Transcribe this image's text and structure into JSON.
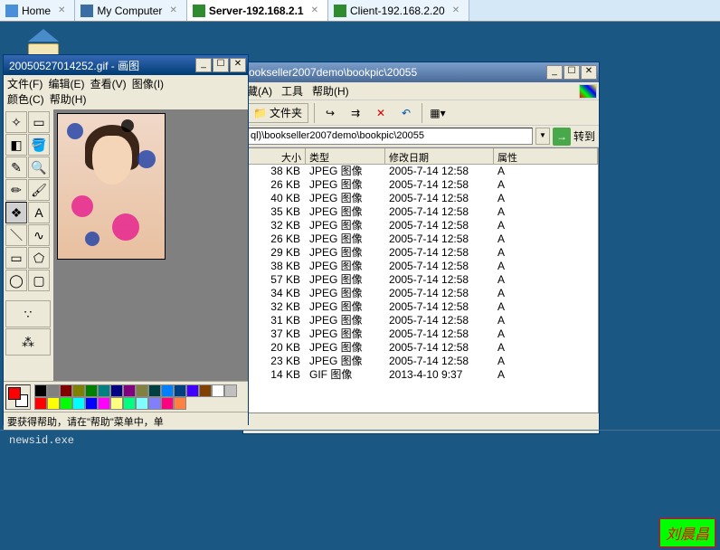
{
  "tabs": [
    {
      "label": "Home",
      "icon": "home"
    },
    {
      "label": "My Computer",
      "icon": "computer"
    },
    {
      "label": "Server-192.168.2.1",
      "icon": "server",
      "active": true
    },
    {
      "label": "Client-192.168.2.20",
      "icon": "client"
    }
  ],
  "paint": {
    "title": "20050527014252.gif - 画图",
    "menus": {
      "file": "文件(F)",
      "edit": "编辑(E)",
      "view": "查看(V)",
      "image": "图像(I)",
      "color": "颜色(C)",
      "help": "帮助(H)"
    },
    "status": "要获得帮助，请在\"帮助\"菜单中，单",
    "palette": [
      "#000000",
      "#808080",
      "#800000",
      "#808000",
      "#008000",
      "#008080",
      "#000080",
      "#800080",
      "#808040",
      "#004040",
      "#0080ff",
      "#004080",
      "#4000ff",
      "#804000",
      "#ffffff",
      "#c0c0c0",
      "#ff0000",
      "#ffff00",
      "#00ff00",
      "#00ffff",
      "#0000ff",
      "#ff00ff",
      "#ffff80",
      "#00ff80",
      "#80ffff",
      "#8080ff",
      "#ff0080",
      "#ff8040"
    ]
  },
  "explorer": {
    "title": "ookseller2007demo\\bookpic\\20055",
    "menus": {
      "fav": "藏(A)",
      "tools": "工具",
      "help": "帮助(H)"
    },
    "folders_btn": "文件夹",
    "go_label": "转到",
    "address": "ql)\\bookseller2007demo\\bookpic\\20055",
    "columns": {
      "size": "大小",
      "type": "类型",
      "modified": "修改日期",
      "attr": "属性"
    },
    "rows": [
      {
        "size": "38 KB",
        "type": "JPEG 图像",
        "modified": "2005-7-14 12:58",
        "attr": "A"
      },
      {
        "size": "26 KB",
        "type": "JPEG 图像",
        "modified": "2005-7-14 12:58",
        "attr": "A"
      },
      {
        "size": "40 KB",
        "type": "JPEG 图像",
        "modified": "2005-7-14 12:58",
        "attr": "A"
      },
      {
        "size": "35 KB",
        "type": "JPEG 图像",
        "modified": "2005-7-14 12:58",
        "attr": "A"
      },
      {
        "size": "32 KB",
        "type": "JPEG 图像",
        "modified": "2005-7-14 12:58",
        "attr": "A"
      },
      {
        "size": "26 KB",
        "type": "JPEG 图像",
        "modified": "2005-7-14 12:58",
        "attr": "A"
      },
      {
        "size": "29 KB",
        "type": "JPEG 图像",
        "modified": "2005-7-14 12:58",
        "attr": "A"
      },
      {
        "size": "38 KB",
        "type": "JPEG 图像",
        "modified": "2005-7-14 12:58",
        "attr": "A"
      },
      {
        "size": "57 KB",
        "type": "JPEG 图像",
        "modified": "2005-7-14 12:58",
        "attr": "A"
      },
      {
        "size": "34 KB",
        "type": "JPEG 图像",
        "modified": "2005-7-14 12:58",
        "attr": "A"
      },
      {
        "size": "32 KB",
        "type": "JPEG 图像",
        "modified": "2005-7-14 12:58",
        "attr": "A"
      },
      {
        "size": "31 KB",
        "type": "JPEG 图像",
        "modified": "2005-7-14 12:58",
        "attr": "A"
      },
      {
        "size": "37 KB",
        "type": "JPEG 图像",
        "modified": "2005-7-14 12:58",
        "attr": "A"
      },
      {
        "size": "20 KB",
        "type": "JPEG 图像",
        "modified": "2005-7-14 12:58",
        "attr": "A"
      },
      {
        "size": "23 KB",
        "type": "JPEG 图像",
        "modified": "2005-7-14 12:58",
        "attr": "A"
      },
      {
        "size": "14 KB",
        "type": "GIF 图像",
        "modified": "2013-4-10 9:37",
        "attr": "A"
      }
    ]
  },
  "cmd_line": "newsid.exe",
  "signature": "刘晨昌"
}
